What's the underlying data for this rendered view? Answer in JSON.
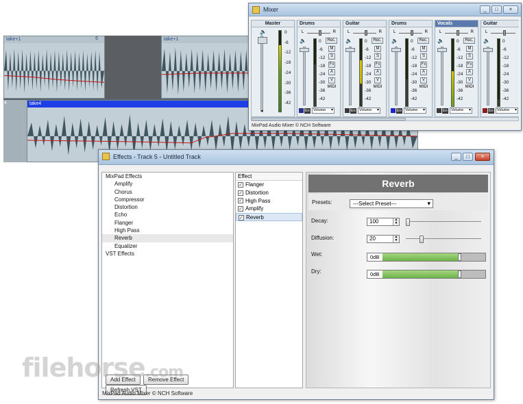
{
  "editor": {
    "clips": [
      {
        "label": "take+1"
      },
      {
        "label": "6"
      },
      {
        "label": "take+1"
      },
      {
        "label": "take4"
      }
    ],
    "track_number": "4"
  },
  "mixer": {
    "title": "Mixer",
    "strips": [
      {
        "name": "Master"
      },
      {
        "name": "Drums"
      },
      {
        "name": "Guitar"
      },
      {
        "name": "Drums"
      },
      {
        "name": "Vocals"
      },
      {
        "name": "Guitar"
      }
    ],
    "scale": [
      "0",
      "-6",
      "-12",
      "-18",
      "-24",
      "-30",
      "-36",
      "-42"
    ],
    "pan_left": "L",
    "pan_right": "R",
    "buttons": {
      "rec": "Rec.",
      "m": "M",
      "s": "S",
      "fx": "Fx",
      "a": "A",
      "v": "V",
      "midi": "MIDI"
    },
    "enable_label": "En",
    "volume_label": "Volume",
    "status": "MixPad Audio Mixer © NCH Software"
  },
  "effects": {
    "title": "Effects - Track 5 - Untitled Track",
    "tree": {
      "root": "MixPad Effects",
      "children": [
        "Amplify",
        "Chorus",
        "Compressor",
        "Distortion",
        "Echo",
        "Flanger",
        "High Pass",
        "Reverb",
        "Equalizer"
      ],
      "vst": "VST Effects"
    },
    "buttons": {
      "add": "Add Effect",
      "remove": "Remove Effect",
      "refresh": "Refresh VST"
    },
    "list_header": "Effect",
    "list": [
      "Flanger",
      "Distortion",
      "High Pass",
      "Amplify",
      "Reverb"
    ],
    "panel": {
      "title": "Reverb",
      "presets_label": "Presets:",
      "preset_value": "---Select Preset---",
      "decay_label": "Decay:",
      "decay_value": "100",
      "diffusion_label": "Diffusion:",
      "diffusion_value": "20",
      "wet_label": "Wet:",
      "wet_value": "0dB",
      "dry_label": "Dry:",
      "dry_value": "0dB"
    },
    "status": "MixPad Audio Mixer © NCH Software"
  },
  "watermark": {
    "text": "filehorse",
    "suffix": ".com"
  }
}
